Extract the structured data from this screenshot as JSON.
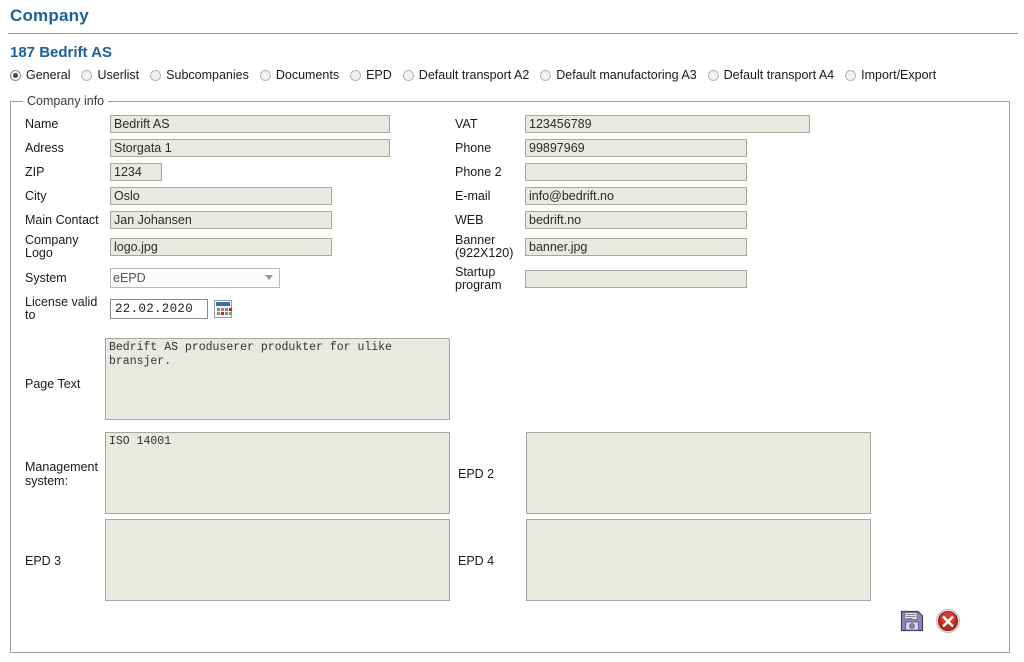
{
  "header": {
    "title": "Company"
  },
  "record": {
    "id": "187",
    "name": "Bedrift AS",
    "title": "187  Bedrift AS"
  },
  "tabs": [
    {
      "label": "General",
      "selected": true,
      "name": "tab-general"
    },
    {
      "label": "Userlist",
      "selected": false,
      "name": "tab-userlist"
    },
    {
      "label": "Subcompanies",
      "selected": false,
      "name": "tab-subcompanies"
    },
    {
      "label": "Documents",
      "selected": false,
      "name": "tab-documents"
    },
    {
      "label": "EPD",
      "selected": false,
      "name": "tab-epd"
    },
    {
      "label": "Default transport A2",
      "selected": false,
      "name": "tab-default-transport-a2"
    },
    {
      "label": "Default manufactoring A3",
      "selected": false,
      "name": "tab-default-manufactoring-a3"
    },
    {
      "label": "Default transport A4",
      "selected": false,
      "name": "tab-default-transport-a4"
    },
    {
      "label": "Import/Export",
      "selected": false,
      "name": "tab-import-export"
    }
  ],
  "fieldset": {
    "legend": "Company info"
  },
  "left_fields": {
    "name": {
      "label": "Name",
      "value": "Bedrift AS"
    },
    "adress": {
      "label": "Adress",
      "value": "Storgata 1"
    },
    "zip": {
      "label": "ZIP",
      "value": "1234"
    },
    "city": {
      "label": "City",
      "value": "Oslo"
    },
    "contact": {
      "label": "Main Contact",
      "value": "Jan Johansen"
    },
    "logo": {
      "label_line1": "Company",
      "label_line2": "Logo",
      "value": "logo.jpg"
    },
    "system": {
      "label": "System",
      "value": "eEPD"
    },
    "license": {
      "label_line1": "License valid",
      "label_line2": "to",
      "value": "22.02.2020"
    }
  },
  "right_fields": {
    "vat": {
      "label": "VAT",
      "value": "123456789"
    },
    "phone": {
      "label": "Phone",
      "value": "99897969"
    },
    "phone2": {
      "label": "Phone 2",
      "value": ""
    },
    "email": {
      "label": "E-mail",
      "value": "info@bedrift.no"
    },
    "web": {
      "label": "WEB",
      "value": "bedrift.no"
    },
    "banner": {
      "label_line1": "Banner",
      "label_line2": "(922X120)",
      "value": "banner.jpg"
    },
    "startup": {
      "label_line1": "Startup",
      "label_line2": "program",
      "value": ""
    }
  },
  "textareas": {
    "page_text": {
      "label": "Page Text",
      "value": "Bedrift AS produserer produkter for ulike bransjer."
    },
    "management": {
      "label_line1": "Management",
      "label_line2": "system:",
      "value": "ISO 14001"
    },
    "epd2": {
      "label": "EPD 2",
      "value": ""
    },
    "epd3": {
      "label": "EPD 3",
      "value": ""
    },
    "epd4": {
      "label": "EPD 4",
      "value": ""
    }
  },
  "actions": {
    "save": {
      "icon": "floppy-disk-save-icon",
      "title": "Save"
    },
    "cancel": {
      "icon": "red-x-cancel-icon",
      "title": "Cancel"
    }
  },
  "colors": {
    "title_blue": "#1d6296",
    "field_fill": "#e9e9e1",
    "field_border": "#a8a8a0",
    "fieldset_border": "#9e9e9e"
  }
}
